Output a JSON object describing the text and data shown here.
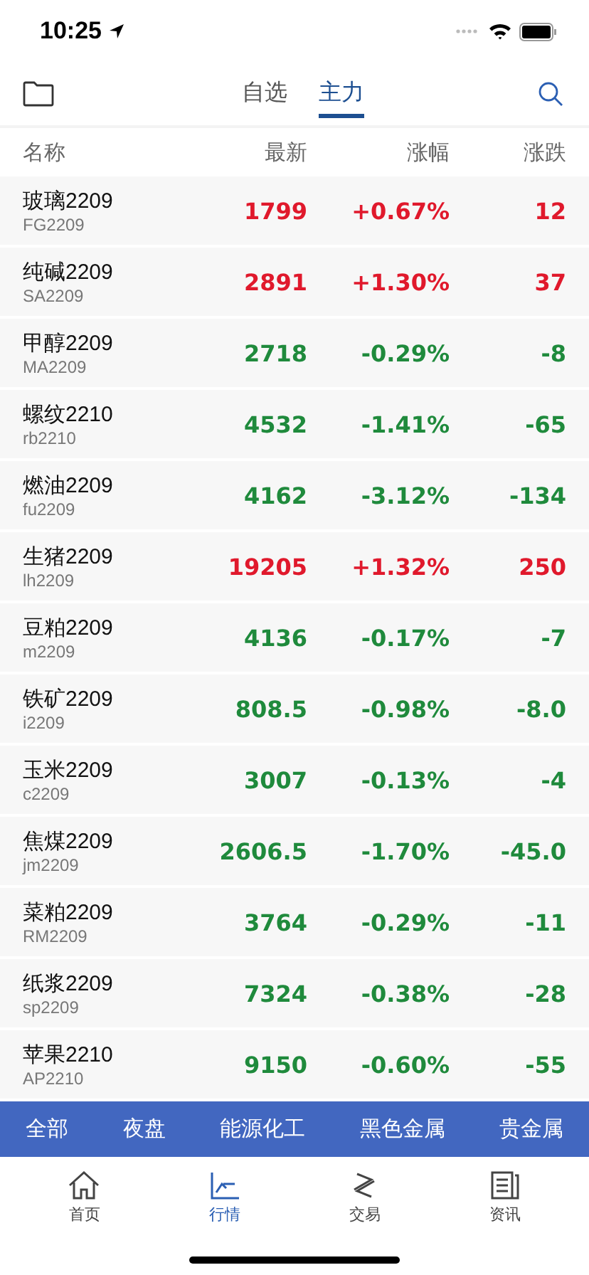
{
  "status_bar": {
    "time": "10:25"
  },
  "tabs": [
    {
      "label": "自选",
      "selected": false
    },
    {
      "label": "主力",
      "selected": true
    }
  ],
  "table": {
    "columns": [
      "名称",
      "最新",
      "涨幅",
      "涨跌"
    ],
    "rows": [
      {
        "name": "玻璃2209",
        "code": "FG2209",
        "last": "1799",
        "pct": "+0.67%",
        "change": "12",
        "color": "#e0192c"
      },
      {
        "name": "纯碱2209",
        "code": "SA2209",
        "last": "2891",
        "pct": "+1.30%",
        "change": "37",
        "color": "#e0192c"
      },
      {
        "name": "甲醇2209",
        "code": "MA2209",
        "last": "2718",
        "pct": "-0.29%",
        "change": "-8",
        "color": "#1f8a3c"
      },
      {
        "name": "螺纹2210",
        "code": "rb2210",
        "last": "4532",
        "pct": "-1.41%",
        "change": "-65",
        "color": "#1f8a3c"
      },
      {
        "name": "燃油2209",
        "code": "fu2209",
        "last": "4162",
        "pct": "-3.12%",
        "change": "-134",
        "color": "#1f8a3c"
      },
      {
        "name": "生猪2209",
        "code": "lh2209",
        "last": "19205",
        "pct": "+1.32%",
        "change": "250",
        "color": "#e0192c"
      },
      {
        "name": "豆粕2209",
        "code": "m2209",
        "last": "4136",
        "pct": "-0.17%",
        "change": "-7",
        "color": "#1f8a3c"
      },
      {
        "name": "铁矿2209",
        "code": "i2209",
        "last": "808.5",
        "pct": "-0.98%",
        "change": "-8.0",
        "color": "#1f8a3c"
      },
      {
        "name": "玉米2209",
        "code": "c2209",
        "last": "3007",
        "pct": "-0.13%",
        "change": "-4",
        "color": "#1f8a3c"
      },
      {
        "name": "焦煤2209",
        "code": "jm2209",
        "last": "2606.5",
        "pct": "-1.70%",
        "change": "-45.0",
        "color": "#1f8a3c"
      },
      {
        "name": "菜粕2209",
        "code": "RM2209",
        "last": "3764",
        "pct": "-0.29%",
        "change": "-11",
        "color": "#1f8a3c"
      },
      {
        "name": "纸浆2209",
        "code": "sp2209",
        "last": "7324",
        "pct": "-0.38%",
        "change": "-28",
        "color": "#1f8a3c"
      },
      {
        "name": "苹果2210",
        "code": "AP2210",
        "last": "9150",
        "pct": "-0.60%",
        "change": "-55",
        "color": "#1f8a3c"
      }
    ]
  },
  "categories": [
    "全部",
    "夜盘",
    "能源化工",
    "黑色金属",
    "贵金属"
  ],
  "bottom_nav": [
    {
      "label": "首页",
      "kind": "home",
      "selected": false
    },
    {
      "label": "行情",
      "kind": "chart",
      "selected": true
    },
    {
      "label": "交易",
      "kind": "trade",
      "selected": false
    },
    {
      "label": "资讯",
      "kind": "news",
      "selected": false
    }
  ]
}
